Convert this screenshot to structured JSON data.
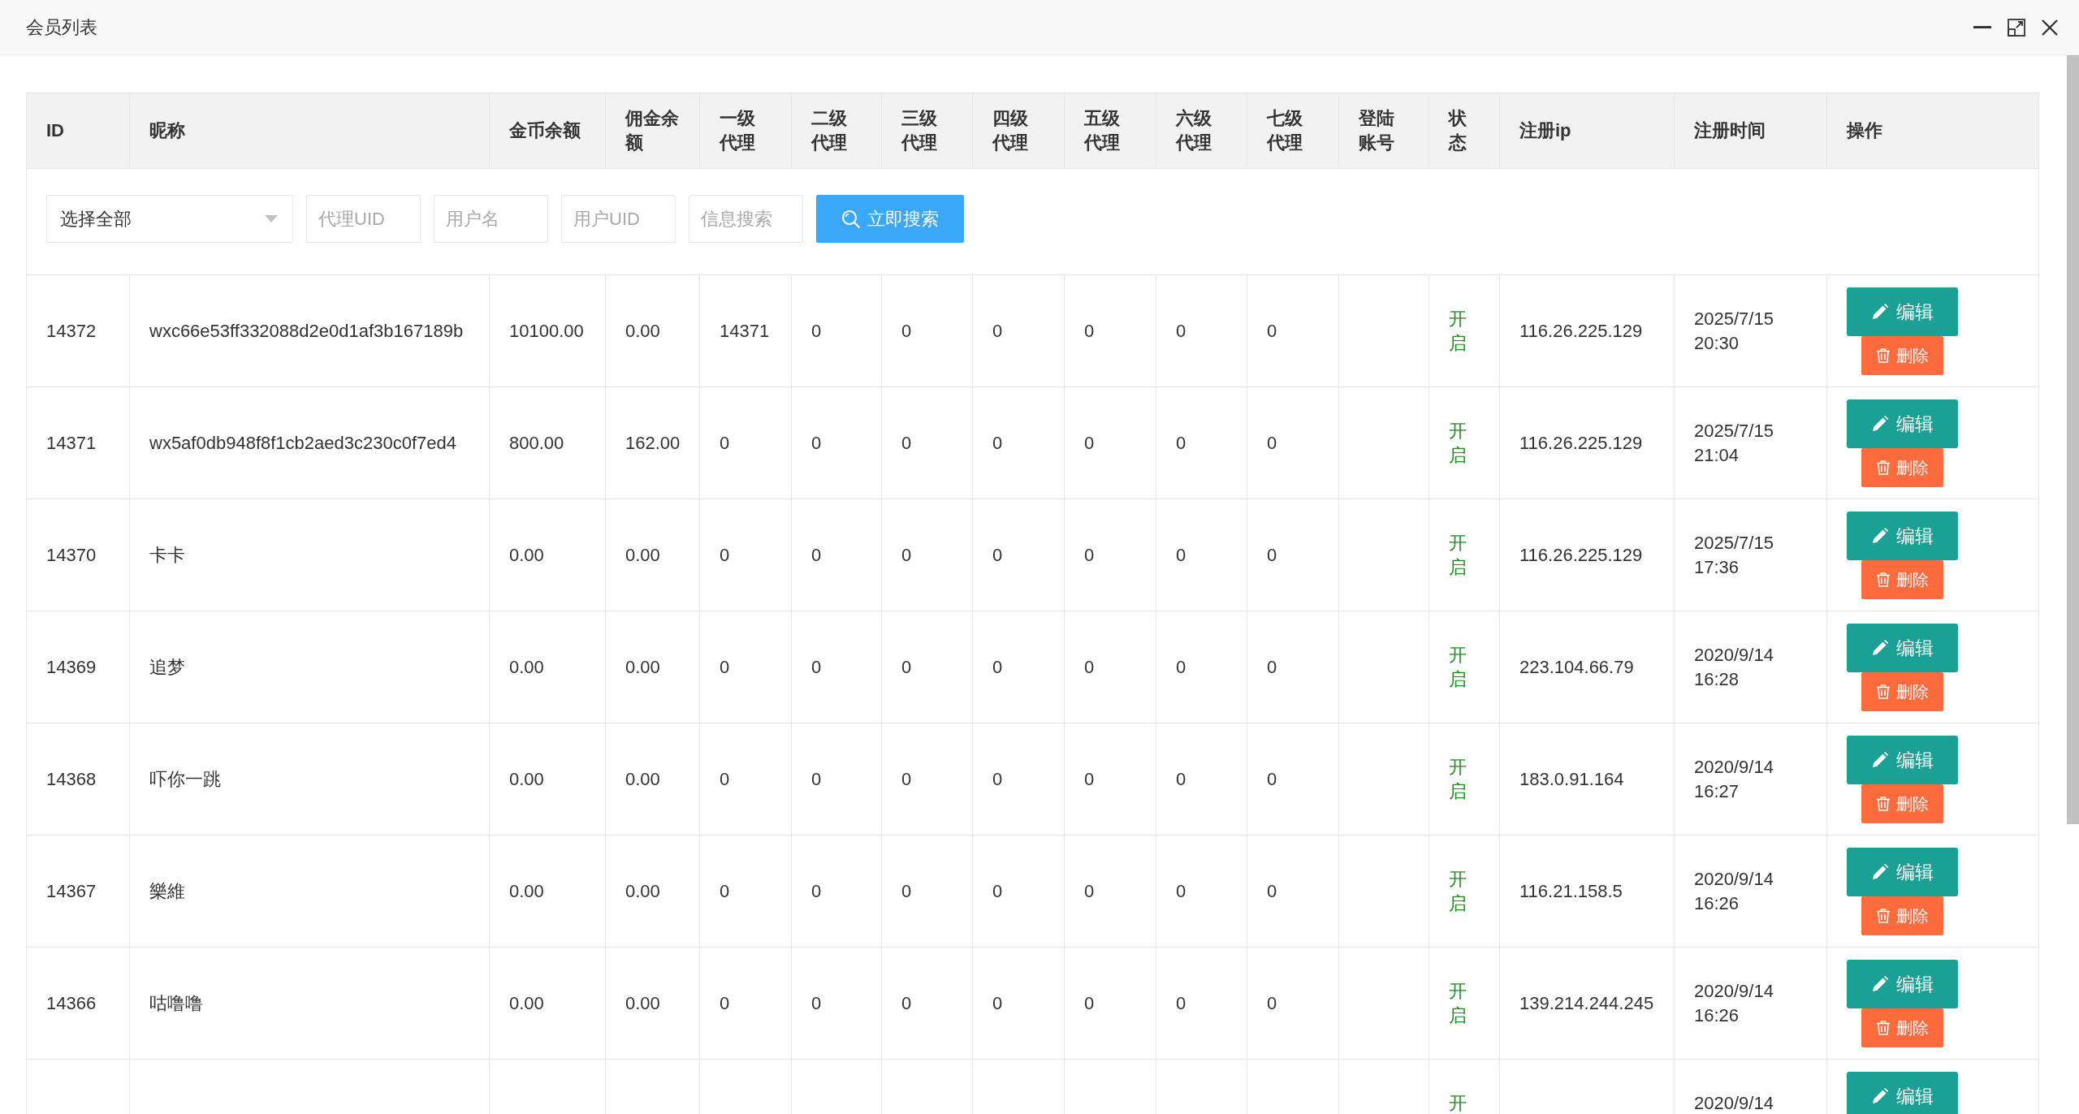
{
  "window": {
    "title": "会员列表"
  },
  "table": {
    "columns": [
      "ID",
      "昵称",
      "金币余额",
      "佣金余额",
      "一级代理",
      "二级代理",
      "三级代理",
      "四级代理",
      "五级代理",
      "六级代理",
      "七级代理",
      "登陆账号",
      "状态",
      "注册ip",
      "注册时间",
      "操作"
    ],
    "filters": {
      "select": {
        "value": "选择全部"
      },
      "fields": [
        {
          "placeholder": "代理UID"
        },
        {
          "placeholder": "用户名"
        },
        {
          "placeholder": "用户UID"
        },
        {
          "placeholder": "信息搜索"
        }
      ],
      "search_button": "立即搜索"
    },
    "rows": [
      {
        "id": "14372",
        "nickname": "wxc66e53ff332088d2e0d1af3b167189b",
        "coin_balance": "10100.00",
        "commission_balance": "0.00",
        "agents": [
          "14371",
          "0",
          "0",
          "0",
          "0",
          "0",
          "0"
        ],
        "status": "开启",
        "register_ip": "116.26.225.129",
        "register_time": "2025/7/15 20:30",
        "actions": [
          {
            "kind": "edit",
            "label": "编辑"
          },
          {
            "kind": "delete",
            "label": "删除"
          }
        ]
      },
      {
        "id": "14371",
        "nickname": "wx5af0db948f8f1cb2aed3c230c0f7ed4",
        "coin_balance": "800.00",
        "commission_balance": "162.00",
        "agents": [
          "0",
          "0",
          "0",
          "0",
          "0",
          "0",
          "0"
        ],
        "status": "开启",
        "register_ip": "116.26.225.129",
        "register_time": "2025/7/15 21:04",
        "actions": [
          {
            "kind": "edit",
            "label": "编辑"
          },
          {
            "kind": "delete",
            "label": "删除"
          }
        ]
      },
      {
        "id": "14370",
        "nickname": "卡卡",
        "coin_balance": "0.00",
        "commission_balance": "0.00",
        "agents": [
          "0",
          "0",
          "0",
          "0",
          "0",
          "0",
          "0"
        ],
        "status": "开启",
        "register_ip": "116.26.225.129",
        "register_time": "2025/7/15 17:36",
        "actions": [
          {
            "kind": "edit",
            "label": "编辑"
          },
          {
            "kind": "delete",
            "label": "删除"
          }
        ]
      },
      {
        "id": "14369",
        "nickname": "追梦",
        "coin_balance": "0.00",
        "commission_balance": "0.00",
        "agents": [
          "0",
          "0",
          "0",
          "0",
          "0",
          "0",
          "0"
        ],
        "status": "开启",
        "register_ip": "223.104.66.79",
        "register_time": "2020/9/14 16:28",
        "actions": [
          {
            "kind": "edit",
            "label": "编辑"
          },
          {
            "kind": "delete",
            "label": "删除"
          }
        ]
      },
      {
        "id": "14368",
        "nickname": "吓你一跳",
        "coin_balance": "0.00",
        "commission_balance": "0.00",
        "agents": [
          "0",
          "0",
          "0",
          "0",
          "0",
          "0",
          "0"
        ],
        "status": "开启",
        "register_ip": "183.0.91.164",
        "register_time": "2020/9/14 16:27",
        "actions": [
          {
            "kind": "edit",
            "label": "编辑"
          },
          {
            "kind": "delete",
            "label": "删除"
          }
        ]
      },
      {
        "id": "14367",
        "nickname": "樂維",
        "coin_balance": "0.00",
        "commission_balance": "0.00",
        "agents": [
          "0",
          "0",
          "0",
          "0",
          "0",
          "0",
          "0"
        ],
        "status": "开启",
        "register_ip": "116.21.158.5",
        "register_time": "2020/9/14 16:26",
        "actions": [
          {
            "kind": "edit",
            "label": "编辑"
          },
          {
            "kind": "delete",
            "label": "删除"
          }
        ]
      },
      {
        "id": "14366",
        "nickname": "咕噜噜",
        "coin_balance": "0.00",
        "commission_balance": "0.00",
        "agents": [
          "0",
          "0",
          "0",
          "0",
          "0",
          "0",
          "0"
        ],
        "status": "开启",
        "register_ip": "139.214.244.245",
        "register_time": "2020/9/14 16:26",
        "actions": [
          {
            "kind": "edit",
            "label": "编辑"
          },
          {
            "kind": "delete",
            "label": "删除"
          }
        ]
      },
      {
        "status": "开",
        "register_time": "2020/9/14",
        "actions": [
          {
            "kind": "edit",
            "label": "编辑"
          }
        ]
      }
    ]
  }
}
